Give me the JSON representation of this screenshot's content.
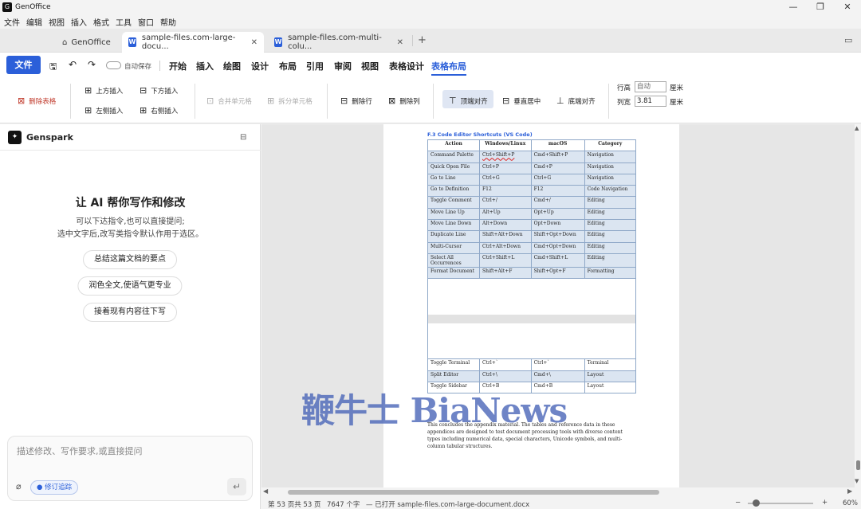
{
  "app": {
    "name": "GenOffice"
  },
  "window": {
    "minimize": "—",
    "restore": "❐",
    "close": "✕"
  },
  "menu": [
    "文件",
    "编辑",
    "视图",
    "插入",
    "格式",
    "工具",
    "窗口",
    "帮助"
  ],
  "tabs": [
    {
      "label": "GenOffice"
    },
    {
      "label": "sample-files.com-large-docu..."
    },
    {
      "label": "sample-files.com-multi-colu..."
    }
  ],
  "ribbon_tabs": {
    "file": "文件",
    "autosave": "自动保存",
    "items": [
      "开始",
      "插入",
      "绘图",
      "设计",
      "布局",
      "引用",
      "审阅",
      "视图",
      "表格设计",
      "表格布局"
    ],
    "active": "表格布局"
  },
  "ribbon": {
    "delete_table": "删除表格",
    "insert_above": "上方插入",
    "insert_below": "下方插入",
    "insert_left": "左侧插入",
    "insert_right": "右侧插入",
    "merge_cells": "合并单元格",
    "split_cells": "拆分单元格",
    "delete_row": "删除行",
    "delete_col": "删除列",
    "align_top": "顶端对齐",
    "align_middle": "垂直居中",
    "align_bottom": "底端对齐",
    "row_height_label": "行高",
    "row_height_value": "自动",
    "col_width_label": "列宽",
    "col_width_value": "3.81",
    "unit": "厘米"
  },
  "sidebar": {
    "title": "Genspark",
    "heading": "让 AI 帮你写作和修改",
    "subtitle1": "可以下达指令,也可以直接提问;",
    "subtitle2": "选中文字后,改写类指令默认作用于选区。",
    "suggestions": [
      "总结这篇文档的要点",
      "润色全文,使语气更专业",
      "接着现有内容往下写"
    ],
    "input_placeholder": "描述修改、写作要求,或直接提问",
    "track_changes": "修订追踪"
  },
  "document": {
    "caption": "F.3 Code Editor Shortcuts (VS Code)",
    "headers": [
      "Action",
      "Windows/Linux",
      "macOS",
      "Category"
    ],
    "rows": [
      [
        "Command Palette",
        "Ctrl+Shift+P",
        "Cmd+Shift+P",
        "Navigation"
      ],
      [
        "Quick Open File",
        "Ctrl+P",
        "Cmd+P",
        "Navigation"
      ],
      [
        "Go to Line",
        "Ctrl+G",
        "Ctrl+G",
        "Navigation"
      ],
      [
        "Go to Definition",
        "F12",
        "F12",
        "Code Navigation"
      ],
      [
        "Toggle Comment",
        "Ctrl+/",
        "Cmd+/",
        "Editing"
      ],
      [
        "Move Line Up",
        "Alt+Up",
        "Opt+Up",
        "Editing"
      ],
      [
        "Move Line Down",
        "Alt+Down",
        "Opt+Down",
        "Editing"
      ],
      [
        "Duplicate Line",
        "Shift+Alt+Down",
        "Shift+Opt+Down",
        "Editing"
      ],
      [
        "Multi-Cursor",
        "Ctrl+Alt+Down",
        "Cmd+Opt+Down",
        "Editing"
      ],
      [
        "Select All Occurrences",
        "Ctrl+Shift+L",
        "Cmd+Shift+L",
        "Editing"
      ],
      [
        "Format Document",
        "Shift+Alt+F",
        "Shift+Opt+F",
        "Formatting"
      ]
    ],
    "rows_after": [
      [
        "Toggle Terminal",
        "Ctrl+`",
        "Ctrl+`",
        "Terminal"
      ],
      [
        "Split Editor",
        "Ctrl+\\",
        "Cmd+\\",
        "Layout"
      ],
      [
        "Toggle Sidebar",
        "Ctrl+B",
        "Cmd+B",
        "Layout"
      ]
    ],
    "paragraph": "This concludes the appendix material. The tables and reference data in these appendices are designed to test document processing tools with diverse content types including numerical data, special characters, Unicode symbols, and multi-column tabular structures."
  },
  "watermark": "鞭牛士 BiaNews",
  "status": {
    "page": "第 53 页共 53 页",
    "words": "7647 个字",
    "opened": "— 已打开 sample-files.com-large-document.docx",
    "minus": "−",
    "plus": "+",
    "zoom": "60%"
  }
}
